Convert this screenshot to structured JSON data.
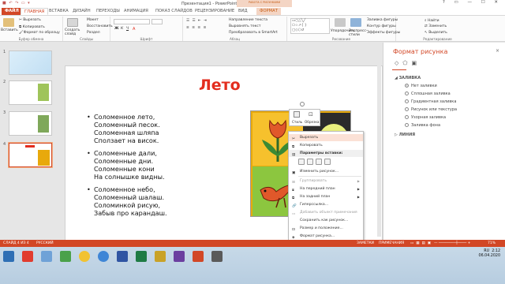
{
  "window": {
    "title": "Презентация1 - PowerPoint",
    "context_tab_group": "РАБОТА С РИСУНКАМИ",
    "controls": "? ▭ — ☐ ✕"
  },
  "tabs": [
    {
      "label": "ФАЙЛ"
    },
    {
      "label": "ГЛАВНАЯ"
    },
    {
      "label": "ВСТАВКА"
    },
    {
      "label": "ДИЗАЙН"
    },
    {
      "label": "ПЕРЕХОДЫ"
    },
    {
      "label": "АНИМАЦИЯ"
    },
    {
      "label": "ПОКАЗ СЛАЙДОВ"
    },
    {
      "label": "РЕЦЕНЗИРОВАНИЕ"
    },
    {
      "label": "ВИД"
    },
    {
      "label": "ФОРМАТ"
    }
  ],
  "ribbon": {
    "clipboard": {
      "paste": "Вставить",
      "cut": "Вырезать",
      "copy": "Копировать",
      "format_painter": "Формат по образцу",
      "group": "Буфер обмена"
    },
    "slides": {
      "new_slide": "Создать слайд",
      "layout": "Макет",
      "reset": "Восстановить",
      "section": "Раздел",
      "group": "Слайды"
    },
    "font": {
      "group": "Шрифт"
    },
    "paragraph": {
      "text_direction": "Направление текста",
      "align_text": "Выровнять текст",
      "smartart": "Преобразовать в SmartArt",
      "group": "Абзац"
    },
    "drawing": {
      "arrange": "Упорядочить",
      "quick_styles": "Экспресс-стили",
      "fill": "Заливка фигуры",
      "outline": "Контур фигуры",
      "effects": "Эффекты фигуры",
      "group": "Рисование"
    },
    "editing": {
      "find": "Найти",
      "replace": "Заменить",
      "select": "Выделить",
      "group": "Редактирование"
    }
  },
  "thumbs": [
    {
      "num": "1"
    },
    {
      "num": "2"
    },
    {
      "num": "3"
    },
    {
      "num": "4"
    }
  ],
  "slide": {
    "title": "Лето",
    "stanzas": [
      [
        "Соломенное лето,",
        "Соломенный песок.",
        "Соломенная шляпа",
        "Сползает на висок."
      ],
      [
        "Соломенные дали,",
        "Соломенные дни.",
        "Соломенные кони",
        "На солнышке видны."
      ],
      [
        "Соломенное небо,",
        "Соломенный шалаш.",
        "Соломинкой рисую,",
        "Забыв про карандаш."
      ]
    ]
  },
  "pic_toolbar": {
    "style": "Стиль",
    "crop": "Обрезка"
  },
  "context_menu": {
    "cut": "Вырезать",
    "copy": "Копировать",
    "paste_options": "Параметры вставки:",
    "change_picture": "Изменить рисунок...",
    "group": "Группировать",
    "bring_forward": "На передний план",
    "send_backward": "На задний план",
    "hyperlink": "Гиперссылка...",
    "alt_text": "Добавить объект примечания",
    "save_as_picture": "Сохранить как рисунок...",
    "size_position": "Размер и положение...",
    "format_picture": "Формат рисунка..."
  },
  "format_pane": {
    "title": "Формат рисунка",
    "close": "×",
    "fill_section": "ЗАЛИВКА",
    "line_section": "ЛИНИЯ",
    "options": [
      "Нет заливки",
      "Сплошная заливка",
      "Градиентная заливка",
      "Рисунок или текстура",
      "Узорная заливка",
      "Заливка фона"
    ],
    "selected_index": 0
  },
  "statusbar": {
    "slide": "СЛАЙД 4 ИЗ 4",
    "lang": "РУССКИЙ",
    "notes": "ЗАМЕТКИ",
    "comments": "ПРИМЕЧАНИЯ",
    "zoom": "71%"
  },
  "taskbar": {
    "time": "2:12",
    "date": "06.04.2020",
    "lang": "RU"
  },
  "colors": {
    "accent": "#d24726",
    "title_red": "#e32d1e",
    "menu_highlight": "#fbe1d6"
  }
}
